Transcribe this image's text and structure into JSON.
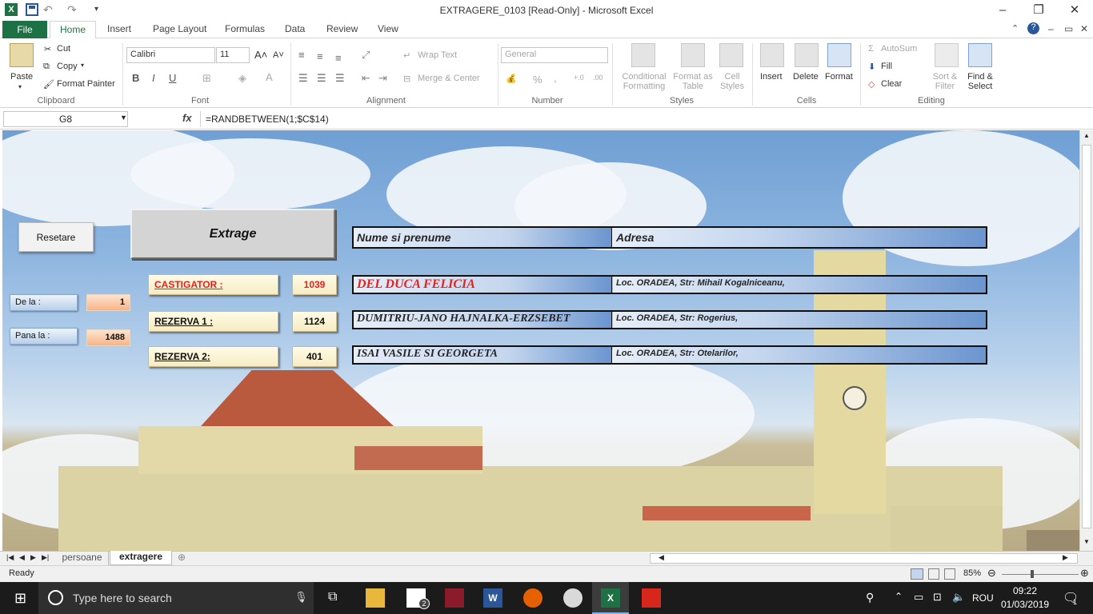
{
  "window": {
    "title": "EXTRAGERE_0103  [Read-Only]  -  Microsoft Excel",
    "minimize": "–",
    "restore": "❐",
    "close": "✕"
  },
  "qat": {
    "undo": "↶",
    "redo": "↷"
  },
  "tabs": {
    "file": "File",
    "home": "Home",
    "insert": "Insert",
    "page_layout": "Page Layout",
    "formulas": "Formulas",
    "data": "Data",
    "review": "Review",
    "view": "View"
  },
  "ribbon": {
    "clipboard": {
      "label": "Clipboard",
      "paste": "Paste",
      "cut": "Cut",
      "copy": "Copy",
      "format_painter": "Format Painter"
    },
    "font": {
      "label": "Font",
      "name": "Calibri",
      "size": "11",
      "bold": "B",
      "italic": "I",
      "underline": "U"
    },
    "alignment": {
      "label": "Alignment",
      "wrap": "Wrap Text",
      "merge": "Merge & Center"
    },
    "number": {
      "label": "Number",
      "format": "General",
      "percent": "%",
      "comma": ","
    },
    "styles": {
      "label": "Styles",
      "conditional": "Conditional Formatting",
      "format_table": "Format as Table",
      "cell_styles": "Cell Styles"
    },
    "cells": {
      "label": "Cells",
      "insert": "Insert",
      "delete": "Delete",
      "format": "Format"
    },
    "editing": {
      "label": "Editing",
      "autosum": "AutoSum",
      "fill": "Fill",
      "clear": "Clear",
      "sort": "Sort & Filter",
      "find": "Find & Select"
    }
  },
  "formula_bar": {
    "name_box": "G8",
    "fx": "fx",
    "formula": "=RANDBETWEEN(1;$C$14)"
  },
  "sheet": {
    "reset_button": "Resetare",
    "draw_button": "Extrage",
    "from_label": "De la :",
    "from_value": "1",
    "to_label": "Pana la :",
    "to_value": "1488",
    "winner_label": "CASTIGATOR :",
    "winner_number": "1039",
    "reserve1_label": "REZERVA 1 :",
    "reserve1_number": "1124",
    "reserve2_label": "REZERVA 2:",
    "reserve2_number": "401",
    "table": {
      "header_name": "Nume si prenume",
      "header_address": "Adresa",
      "rows": [
        {
          "name": "DEL DUCA FELICIA",
          "address": "Loc. ORADEA, Str: Mihail Kogalniceanu,"
        },
        {
          "name": "DUMITRIU-JANO HAJNALKA-ERZSEBET",
          "address": "Loc. ORADEA, Str: Rogerius,"
        },
        {
          "name": "ISAI VASILE SI GEORGETA",
          "address": "Loc. ORADEA, Str: Otelarilor,"
        }
      ]
    },
    "colors": {
      "winner_red": "#e8201e",
      "header_blue": "#6b95cf"
    }
  },
  "sheet_tabs": [
    "persoane",
    "extragere"
  ],
  "status": {
    "ready": "Ready",
    "zoom": "85%"
  },
  "taskbar": {
    "search_placeholder": "Type here to search",
    "language": "ROU",
    "time": "09:22",
    "date": "01/03/2019",
    "mail_badge": "2",
    "notif_badge": "1"
  }
}
